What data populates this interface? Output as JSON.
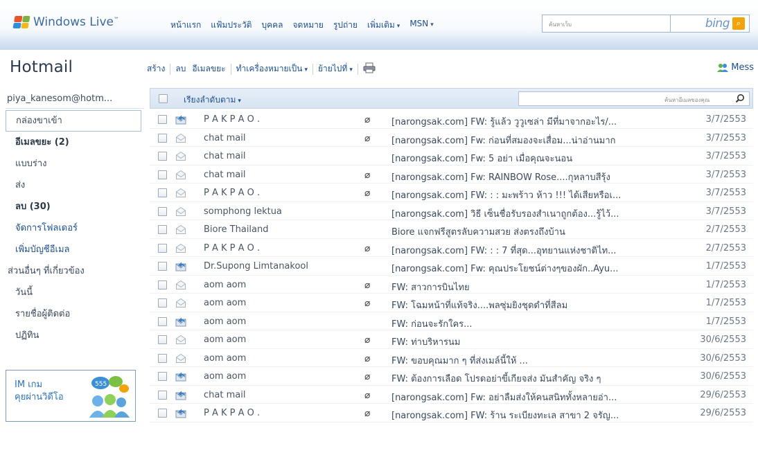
{
  "header": {
    "brand": "Windows Live",
    "brand_tm": "™",
    "nav": [
      {
        "label": "หน้าแรก",
        "dropdown": false
      },
      {
        "label": "แฟ้มประวัติ",
        "dropdown": false
      },
      {
        "label": "บุคคล",
        "dropdown": false
      },
      {
        "label": "จดหมาย",
        "dropdown": false
      },
      {
        "label": "รูปถ่าย",
        "dropdown": false
      },
      {
        "label": "เพิ่มเติม",
        "dropdown": true
      },
      {
        "label": "MSN",
        "dropdown": true
      }
    ],
    "search_placeholder": "ค้นหาเว็บ",
    "search_engine": "bing"
  },
  "app": {
    "title": "Hotmail"
  },
  "toolbar": {
    "new": "สร้าง",
    "delete": "ลบ",
    "junk": "อีเมลขยะ",
    "mark_as": "ทำเครื่องหมายเป็น",
    "move_to": "ย้ายไปที่",
    "print_icon": "printer-icon",
    "messenger": "Mess"
  },
  "sidebar": {
    "account": "piya_kanesom@hotm...",
    "folders": [
      {
        "label": "กล่องขาเข้า",
        "active": true,
        "style": "normal"
      },
      {
        "label": "อีเมลขยะ (2)",
        "active": false,
        "style": "bold"
      },
      {
        "label": "แบบร่าง",
        "active": false,
        "style": "normal"
      },
      {
        "label": "ส่ง",
        "active": false,
        "style": "normal"
      },
      {
        "label": "ลบ (30)",
        "active": false,
        "style": "bold"
      },
      {
        "label": "จัดการโฟลเดอร์",
        "active": false,
        "style": "link"
      },
      {
        "label": "เพิ่มบัญชีอีเมล",
        "active": false,
        "style": "link"
      }
    ],
    "related_header": "ส่วนอื่นๆ ที่เกี่ยวข้อง",
    "related": [
      {
        "label": "วันนี้"
      },
      {
        "label": "รายชื่อผู้ติดต่อ"
      },
      {
        "label": "ปฏิทิน"
      }
    ],
    "ad": {
      "line1": "IM เกม",
      "line2": "คุยผ่านวิดีโอ",
      "bubble_text": "555"
    }
  },
  "list": {
    "sort_label": "เรียงลำดับตาม",
    "search_placeholder": "ค้นหาอีเมลของคุณ",
    "colors": {
      "replied_icon": "#3c7fc4",
      "read_icon": "#a9b4bf"
    },
    "rows": [
      {
        "sender": "P A K P A O .",
        "icon": "replied",
        "attachment": true,
        "subject": "[narongsak.com] FW: รู้แล้ว วูวูเซล่า มีที่มาจากอะไร/...",
        "date": "3/7/2553"
      },
      {
        "sender": "chat mail",
        "icon": "read",
        "attachment": true,
        "subject": "[narongsak.com] Fw: ก่อนที่สมองจะเสื่อม...น่าอ่านมาก",
        "date": "3/7/2553"
      },
      {
        "sender": "chat mail",
        "icon": "read",
        "attachment": false,
        "subject": "[narongsak.com] Fw: 5 อย่า เมื่อคุณจะนอน",
        "date": "3/7/2553"
      },
      {
        "sender": "chat mail",
        "icon": "read",
        "attachment": true,
        "subject": "[narongsak.com] Fw: RAINBOW Rose....กุหลาบสีรุ้ง",
        "date": "3/7/2553"
      },
      {
        "sender": "P A K P A O .",
        "icon": "read",
        "attachment": true,
        "subject": "[narongsak.com] FW: : : มะพร้าว ห้าว !!! ได้เสียหรือเ...",
        "date": "3/7/2553"
      },
      {
        "sender": "somphong lektua",
        "icon": "read",
        "attachment": false,
        "subject": "[narongsak.com] วิธี เซ็นชื่อรับรองสำเนาถูกต้อง...รู้ไว้...",
        "date": "3/7/2553"
      },
      {
        "sender": "Biore Thailand",
        "icon": "read",
        "attachment": false,
        "subject": "Biore แจกฟรีสูตรลับความสวย ส่งตรงถึงบ้าน",
        "date": "2/7/2553"
      },
      {
        "sender": "P A K P A O .",
        "icon": "read",
        "attachment": true,
        "subject": "[narongsak.com] FW: : : 7 ที่สุด...อุทยานแห่งชาติไท...",
        "date": "2/7/2553"
      },
      {
        "sender": "Dr.Supong Limtanakool",
        "icon": "replied",
        "attachment": false,
        "subject": "[narongsak.com] Fw: คุณประโยชน์ต่างๆของผัก..Ayu...",
        "date": "1/7/2553"
      },
      {
        "sender": "aom aom",
        "icon": "read",
        "attachment": true,
        "subject": "FW: สาวการบินไทย",
        "date": "1/7/2553"
      },
      {
        "sender": "aom aom",
        "icon": "read",
        "attachment": true,
        "subject": "FW: โฉมหน้าที่แท้จริง....พลซุ่มยิงชุดดำที่สีลม",
        "date": "1/7/2553"
      },
      {
        "sender": "aom aom",
        "icon": "replied",
        "attachment": false,
        "subject": "FW: ก่อนจะรักใคร...",
        "date": "1/7/2553"
      },
      {
        "sender": "aom aom",
        "icon": "read",
        "attachment": true,
        "subject": "FW: ท่าบริหารนม",
        "date": "30/6/2553"
      },
      {
        "sender": "aom aom",
        "icon": "read",
        "attachment": true,
        "subject": "FW: ขอบคุณมาก ๆ ที่ส่งเมล์นี้ให้ ...",
        "date": "30/6/2553"
      },
      {
        "sender": "aom aom",
        "icon": "replied",
        "attachment": true,
        "subject": "FW: ต้องการเลือด โปรดอย่าขี้เกียจส่ง มันสำคัญ จริง ๆ",
        "date": "30/6/2553"
      },
      {
        "sender": "chat mail",
        "icon": "replied",
        "attachment": true,
        "subject": "[narongsak.com] Fw: อย่าลืมส่งให้คนสนิททั้งหลายอ่า...",
        "date": "29/6/2553"
      },
      {
        "sender": "P A K P A O .",
        "icon": "replied",
        "attachment": true,
        "subject": "[narongsak.com] FW: ร้าน ระเบียงทะเล สาขา 2 จรัญ...",
        "date": "29/6/2553"
      }
    ]
  }
}
